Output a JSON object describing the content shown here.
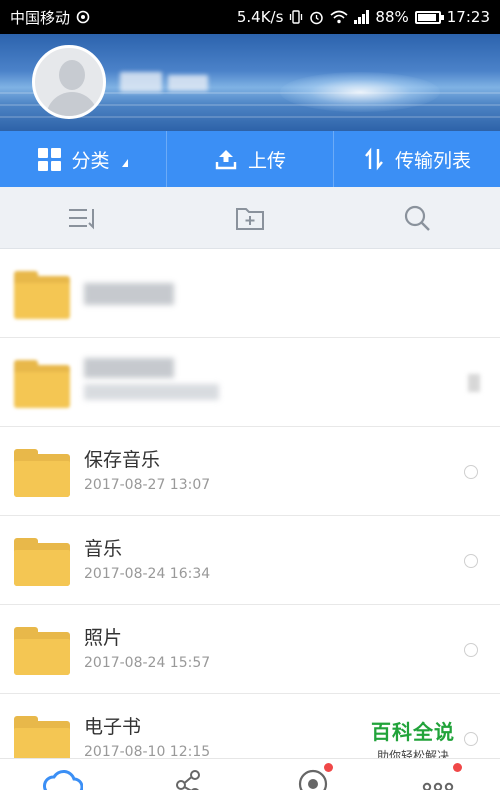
{
  "status_bar": {
    "carrier": "中国移动",
    "net_speed": "5.4K/s",
    "battery_percent": "88%",
    "battery_level": 0.88,
    "time": "17:23"
  },
  "action_bar": {
    "category_label": "分类",
    "upload_label": "上传",
    "transfer_list_label": "传输列表"
  },
  "files": [
    {
      "name": "保存音乐",
      "date": "2017-08-27  13:07"
    },
    {
      "name": "音乐",
      "date": "2017-08-24  16:34"
    },
    {
      "name": "照片",
      "date": "2017-08-24  15:57"
    },
    {
      "name": "电子书",
      "date": "2017-08-10  12:15"
    }
  ],
  "watermark": {
    "title": "百科全说",
    "subtitle": "助你轻松解决"
  },
  "colors": {
    "accent": "#3b8ff5",
    "folder": "#f4c653",
    "badge": "#f04848",
    "watermark": "#21a33a"
  }
}
